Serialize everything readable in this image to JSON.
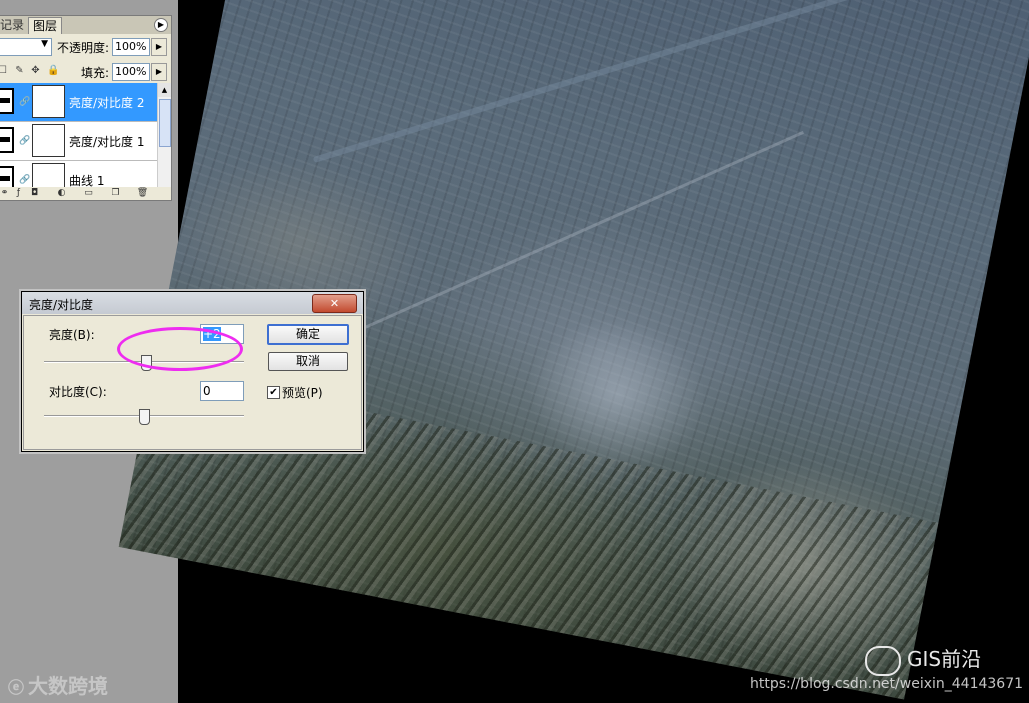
{
  "layers_panel": {
    "tabs": [
      "记录",
      "图层"
    ],
    "blend_mode": "",
    "opacity_label": "不透明度:",
    "opacity_value": "100%",
    "fill_label": "填充:",
    "fill_value": "100%",
    "layers": [
      {
        "name": "亮度/对比度 2",
        "selected": true
      },
      {
        "name": "亮度/对比度 1",
        "selected": false
      },
      {
        "name": "曲线 1",
        "selected": false
      }
    ],
    "lock_icons": [
      "lock-transparent-icon",
      "lock-paint-icon",
      "lock-move-icon",
      "lock-all-icon"
    ],
    "bottom_icons": [
      "link-layers-icon",
      "layer-style-icon",
      "add-mask-icon",
      "new-adjustment-icon",
      "new-group-icon",
      "new-layer-icon",
      "delete-layer-icon"
    ]
  },
  "dialog": {
    "title": "亮度/对比度",
    "brightness_label": "亮度(B):",
    "brightness_value": "+2",
    "brightness_level": 2,
    "contrast_label": "对比度(C):",
    "contrast_value": "0",
    "contrast_level": 0,
    "ok_label": "确定",
    "cancel_label": "取消",
    "preview_label": "预览(P)",
    "preview_checked": true,
    "highlight_color": "#ee2cf0"
  },
  "watermarks": {
    "left_text": "大数跨境",
    "gis_text": "GIS前沿",
    "url_text": "https://blog.csdn.net/weixin_44143671"
  }
}
